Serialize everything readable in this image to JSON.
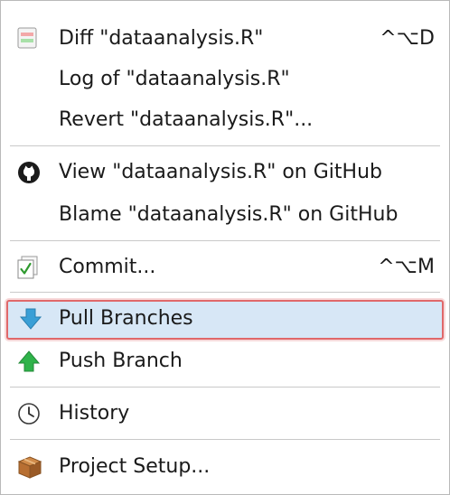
{
  "menu": {
    "items": [
      {
        "label": "Diff \"dataanalysis.R\"",
        "shortcut": "^⌥D",
        "icon": "diff-icon"
      },
      {
        "label": "Log of \"dataanalysis.R\"",
        "shortcut": "",
        "icon": ""
      },
      {
        "label": "Revert \"dataanalysis.R\"...",
        "shortcut": "",
        "icon": ""
      },
      {
        "label": "View \"dataanalysis.R\" on GitHub",
        "shortcut": "",
        "icon": "github-icon"
      },
      {
        "label": "Blame \"dataanalysis.R\" on GitHub",
        "shortcut": "",
        "icon": ""
      },
      {
        "label": "Commit...",
        "shortcut": "^⌥M",
        "icon": "commit-icon"
      },
      {
        "label": "Pull Branches",
        "shortcut": "",
        "icon": "pull-arrow-icon",
        "highlighted": true
      },
      {
        "label": "Push Branch",
        "shortcut": "",
        "icon": "push-arrow-icon"
      },
      {
        "label": "History",
        "shortcut": "",
        "icon": "clock-icon"
      },
      {
        "label": "Project Setup...",
        "shortcut": "",
        "icon": "package-icon"
      }
    ]
  },
  "colors": {
    "highlight_bg": "#d7e7f6",
    "highlight_border": "#e0686a",
    "pull_arrow": "#3a9fd6",
    "push_arrow": "#2fb34a"
  }
}
